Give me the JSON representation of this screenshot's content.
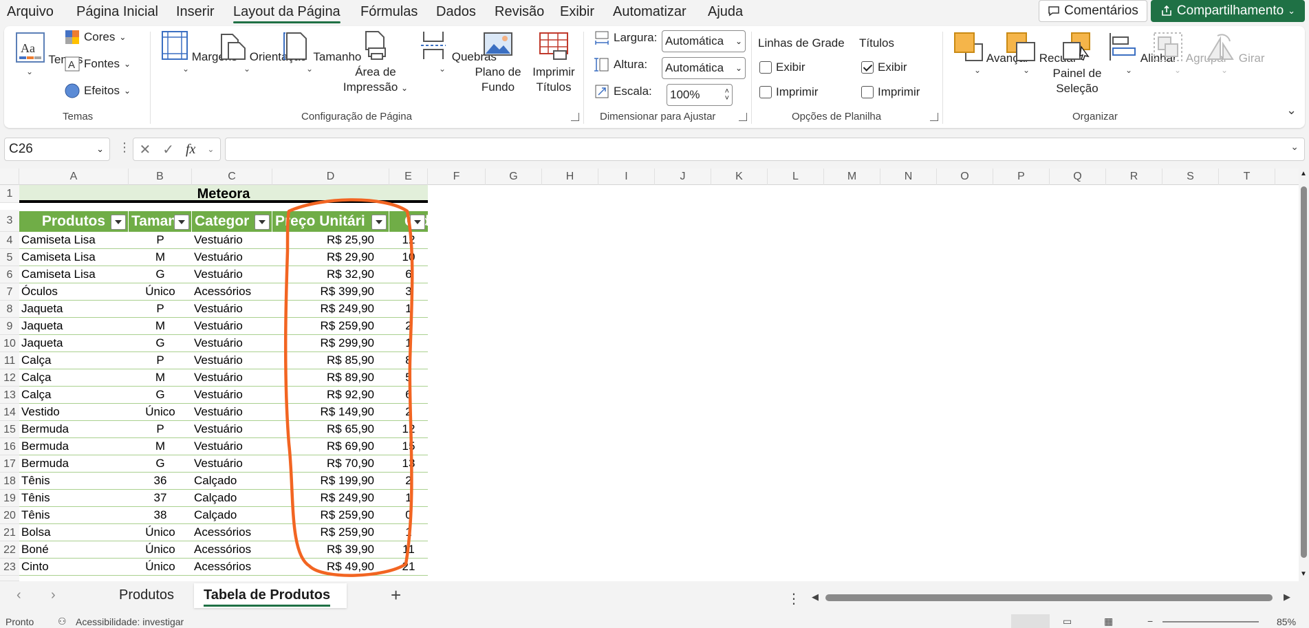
{
  "menu": {
    "items": [
      "Arquivo",
      "Página Inicial",
      "Inserir",
      "Layout da Página",
      "Fórmulas",
      "Dados",
      "Revisão",
      "Exibir",
      "Automatizar",
      "Ajuda"
    ],
    "active": "Layout da Página",
    "comments_label": "Comentários",
    "share_label": "Compartilhamento"
  },
  "ribbon": {
    "temas": {
      "label": "Temas",
      "cores": "Cores",
      "fontes": "Fontes",
      "efeitos": "Efeitos",
      "group": "Temas"
    },
    "config": {
      "margens": "Margens",
      "orientacao": "Orientação",
      "tamanho": "Tamanho",
      "area1": "Área de",
      "area2": "Impressão",
      "quebras": "Quebras",
      "plano1": "Plano de",
      "plano2": "Fundo",
      "imprimir1": "Imprimir",
      "imprimir2": "Títulos",
      "group": "Configuração de Página"
    },
    "dimensionar": {
      "largura_label": "Largura:",
      "largura_value": "Automática",
      "altura_label": "Altura:",
      "altura_value": "Automática",
      "escala_label": "Escala:",
      "escala_value": "100%",
      "group": "Dimensionar para Ajustar"
    },
    "opcoes": {
      "linhas_title": "Linhas de Grade",
      "titulos_title": "Títulos",
      "exibir": "Exibir",
      "imprimir": "Imprimir",
      "group": "Opções de Planilha",
      "linhas_exibir": false,
      "linhas_imprimir": false,
      "titulos_exibir": true,
      "titulos_imprimir": false
    },
    "organizar": {
      "avancar": "Avançar",
      "recuar": "Recuar",
      "painel1": "Painel de",
      "painel2": "Seleção",
      "alinhar": "Alinhar",
      "agrupar": "Agrupar",
      "girar": "Girar",
      "group": "Organizar"
    }
  },
  "formula_bar": {
    "name_box": "C26",
    "fx": "fx",
    "formula": ""
  },
  "columns": [
    "A",
    "B",
    "C",
    "D",
    "E",
    "F",
    "G",
    "H",
    "I",
    "J",
    "K",
    "L",
    "M",
    "N",
    "O",
    "P",
    "Q",
    "R",
    "S",
    "T"
  ],
  "sheet": {
    "title": "Meteora",
    "headers": [
      "Produtos",
      "Tamanh",
      "Categor",
      "Preço Unitári",
      "Qtd"
    ],
    "rows": [
      [
        "4",
        "Camiseta Lisa",
        "P",
        "Vestuário",
        "R$ 25,90",
        "12"
      ],
      [
        "5",
        "Camiseta Lisa",
        "M",
        "Vestuário",
        "R$ 29,90",
        "10"
      ],
      [
        "6",
        "Camiseta Lisa",
        "G",
        "Vestuário",
        "R$ 32,90",
        "6"
      ],
      [
        "7",
        "Óculos",
        "Único",
        "Acessórios",
        "R$ 399,90",
        "3"
      ],
      [
        "8",
        "Jaqueta",
        "P",
        "Vestuário",
        "R$ 249,90",
        "1"
      ],
      [
        "9",
        "Jaqueta",
        "M",
        "Vestuário",
        "R$ 259,90",
        "2"
      ],
      [
        "10",
        "Jaqueta",
        "G",
        "Vestuário",
        "R$ 299,90",
        "1"
      ],
      [
        "11",
        "Calça",
        "P",
        "Vestuário",
        "R$ 85,90",
        "8"
      ],
      [
        "12",
        "Calça",
        "M",
        "Vestuário",
        "R$ 89,90",
        "5"
      ],
      [
        "13",
        "Calça",
        "G",
        "Vestuário",
        "R$ 92,90",
        "6"
      ],
      [
        "14",
        "Vestido",
        "Único",
        "Vestuário",
        "R$ 149,90",
        "2"
      ],
      [
        "15",
        "Bermuda",
        "P",
        "Vestuário",
        "R$ 65,90",
        "12"
      ],
      [
        "16",
        "Bermuda",
        "M",
        "Vestuário",
        "R$ 69,90",
        "15"
      ],
      [
        "17",
        "Bermuda",
        "G",
        "Vestuário",
        "R$ 70,90",
        "13"
      ],
      [
        "18",
        "Tênis",
        "36",
        "Calçado",
        "R$ 199,90",
        "2"
      ],
      [
        "19",
        "Tênis",
        "37",
        "Calçado",
        "R$ 249,90",
        "1"
      ],
      [
        "20",
        "Tênis",
        "38",
        "Calçado",
        "R$ 259,90",
        "0"
      ],
      [
        "21",
        "Bolsa",
        "Único",
        "Acessórios",
        "R$ 259,90",
        "1"
      ],
      [
        "22",
        "Boné",
        "Único",
        "Acessórios",
        "R$ 39,90",
        "11"
      ],
      [
        "23",
        "Cinto",
        "Único",
        "Acessórios",
        "R$ 49,90",
        "21"
      ]
    ]
  },
  "tabs": {
    "sheet1": "Produtos",
    "sheet2": "Tabela de Produtos",
    "add": "+"
  },
  "status": {
    "ready": "Pronto",
    "accessibility": "Acessibilidade: investigar",
    "zoom": "85%"
  },
  "colors": {
    "accent": "#1f7145",
    "table_header": "#70ad47",
    "title_band": "#e2efda",
    "annotation": "#f26522"
  }
}
